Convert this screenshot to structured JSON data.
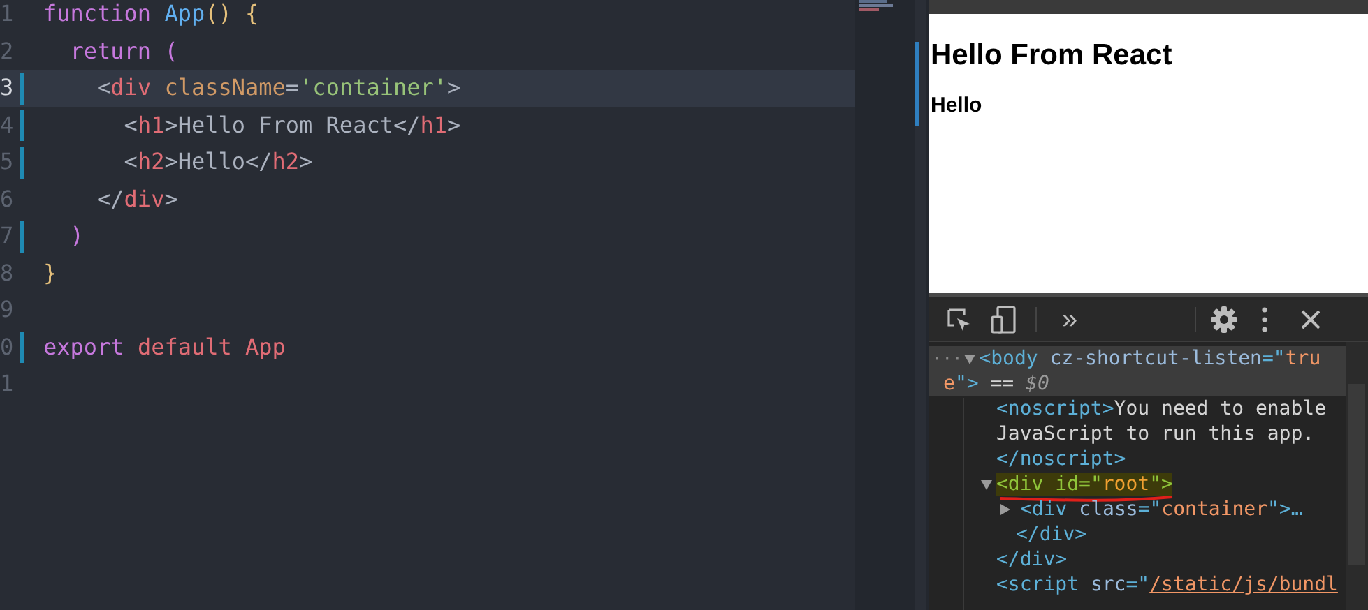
{
  "editor": {
    "lines": [
      {
        "number": "1",
        "modified": false,
        "selected": false,
        "tokens": [
          {
            "text": "function ",
            "kind": "keyword"
          },
          {
            "text": "App",
            "kind": "function"
          },
          {
            "text": "() {",
            "kind": "brace"
          }
        ]
      },
      {
        "number": "2",
        "modified": false,
        "selected": false,
        "tokens": [
          {
            "text": "  return ",
            "kind": "keyword"
          },
          {
            "text": "(",
            "kind": "paren"
          }
        ]
      },
      {
        "number": "3",
        "modified": true,
        "selected": true,
        "tokens": [
          {
            "text": "    <",
            "kind": "bracket"
          },
          {
            "text": "div ",
            "kind": "tag"
          },
          {
            "text": "className",
            "kind": "attr"
          },
          {
            "text": "=",
            "kind": "text"
          },
          {
            "text": "'container'",
            "kind": "string"
          },
          {
            "text": ">",
            "kind": "bracket"
          }
        ]
      },
      {
        "number": "4",
        "modified": true,
        "selected": false,
        "tokens": [
          {
            "text": "      <",
            "kind": "bracket"
          },
          {
            "text": "h1",
            "kind": "tag"
          },
          {
            "text": ">Hello From React</",
            "kind": "text"
          },
          {
            "text": "h1",
            "kind": "tag"
          },
          {
            "text": ">",
            "kind": "bracket"
          }
        ]
      },
      {
        "number": "5",
        "modified": true,
        "selected": false,
        "tokens": [
          {
            "text": "      <",
            "kind": "bracket"
          },
          {
            "text": "h2",
            "kind": "tag"
          },
          {
            "text": ">Hello</",
            "kind": "text"
          },
          {
            "text": "h2",
            "kind": "tag"
          },
          {
            "text": ">",
            "kind": "bracket"
          }
        ]
      },
      {
        "number": "6",
        "modified": false,
        "selected": false,
        "tokens": [
          {
            "text": "    </",
            "kind": "bracket"
          },
          {
            "text": "div",
            "kind": "tag"
          },
          {
            "text": ">",
            "kind": "bracket"
          }
        ]
      },
      {
        "number": "7",
        "modified": true,
        "selected": false,
        "tokens": [
          {
            "text": "  )",
            "kind": "paren"
          }
        ]
      },
      {
        "number": "8",
        "modified": false,
        "selected": false,
        "tokens": [
          {
            "text": "}",
            "kind": "brace"
          }
        ]
      },
      {
        "number": "9",
        "modified": false,
        "selected": false
      },
      {
        "number": "0",
        "modified": true,
        "selected": false,
        "tokens": [
          {
            "text": "export ",
            "kind": "keyword"
          },
          {
            "text": "default App",
            "kind": "tag"
          }
        ]
      },
      {
        "number": "1",
        "modified": false,
        "selected": false
      }
    ]
  },
  "preview": {
    "heading_1": "Hello From React",
    "heading_2": "Hello"
  },
  "devtools": {
    "toolbar": {
      "more_tabs": "»"
    },
    "nodes": [
      {
        "selected": true,
        "expanded": true,
        "highlighted": false,
        "dots": "···",
        "lines": [
          {
            "tokens": [
              {
                "text": "<body ",
                "kind": "tag"
              },
              {
                "text": "cz-shortcut-listen",
                "kind": "attr"
              },
              {
                "text": "=\"",
                "kind": "tag"
              },
              {
                "text": "tru",
                "kind": "value"
              }
            ]
          },
          {
            "tokens": [
              {
                "text": "e",
                "kind": "value"
              },
              {
                "text": "\">",
                "kind": "tag"
              },
              {
                "text": " == ",
                "kind": "text"
              },
              {
                "text": "$0",
                "kind": "ref"
              }
            ]
          }
        ],
        "children": [
          {
            "selected": false,
            "highlighted": false,
            "lines": [
              {
                "tokens": [
                  {
                    "text": "<noscript>",
                    "kind": "tag"
                  },
                  {
                    "text": "You need to enable",
                    "kind": "text"
                  }
                ]
              },
              {
                "tokens": [
                  {
                    "text": "JavaScript to run this app.",
                    "kind": "text"
                  }
                ]
              },
              {
                "tokens": [
                  {
                    "text": "</noscript>",
                    "kind": "tag"
                  }
                ]
              }
            ]
          },
          {
            "selected": false,
            "expanded": true,
            "highlighted": true,
            "underlined": true,
            "lines": [
              {
                "tokens": [
                  {
                    "text": "<div ",
                    "kind": "tag"
                  },
                  {
                    "text": "id",
                    "kind": "attr"
                  },
                  {
                    "text": "=\"",
                    "kind": "tag"
                  },
                  {
                    "text": "root",
                    "kind": "value"
                  },
                  {
                    "text": "\">",
                    "kind": "tag"
                  }
                ]
              }
            ],
            "children": [
              {
                "selected": false,
                "expanded": false,
                "highlighted": false,
                "lines": [
                  {
                    "tokens": [
                      {
                        "text": "<div ",
                        "kind": "tag"
                      },
                      {
                        "text": "class",
                        "kind": "attr"
                      },
                      {
                        "text": "=\"",
                        "kind": "tag"
                      },
                      {
                        "text": "container",
                        "kind": "value"
                      },
                      {
                        "text": "\">…",
                        "kind": "tag"
                      }
                    ]
                  }
                ]
              },
              {
                "selected": false,
                "highlighted": false,
                "lines": [
                  {
                    "tokens": [
                      {
                        "text": "</div>",
                        "kind": "tag"
                      }
                    ]
                  }
                ]
              }
            ]
          },
          {
            "selected": false,
            "highlighted": false,
            "lines": [
              {
                "tokens": [
                  {
                    "text": "</div>",
                    "kind": "tag"
                  }
                ]
              }
            ]
          },
          {
            "selected": false,
            "highlighted": false,
            "lines": [
              {
                "tokens": [
                  {
                    "text": "<script ",
                    "kind": "tag"
                  },
                  {
                    "text": "src",
                    "kind": "attr"
                  },
                  {
                    "text": "=\"",
                    "kind": "tag"
                  },
                  {
                    "text": "/static/js/bundl",
                    "kind": "link"
                  }
                ]
              }
            ]
          }
        ]
      }
    ]
  }
}
